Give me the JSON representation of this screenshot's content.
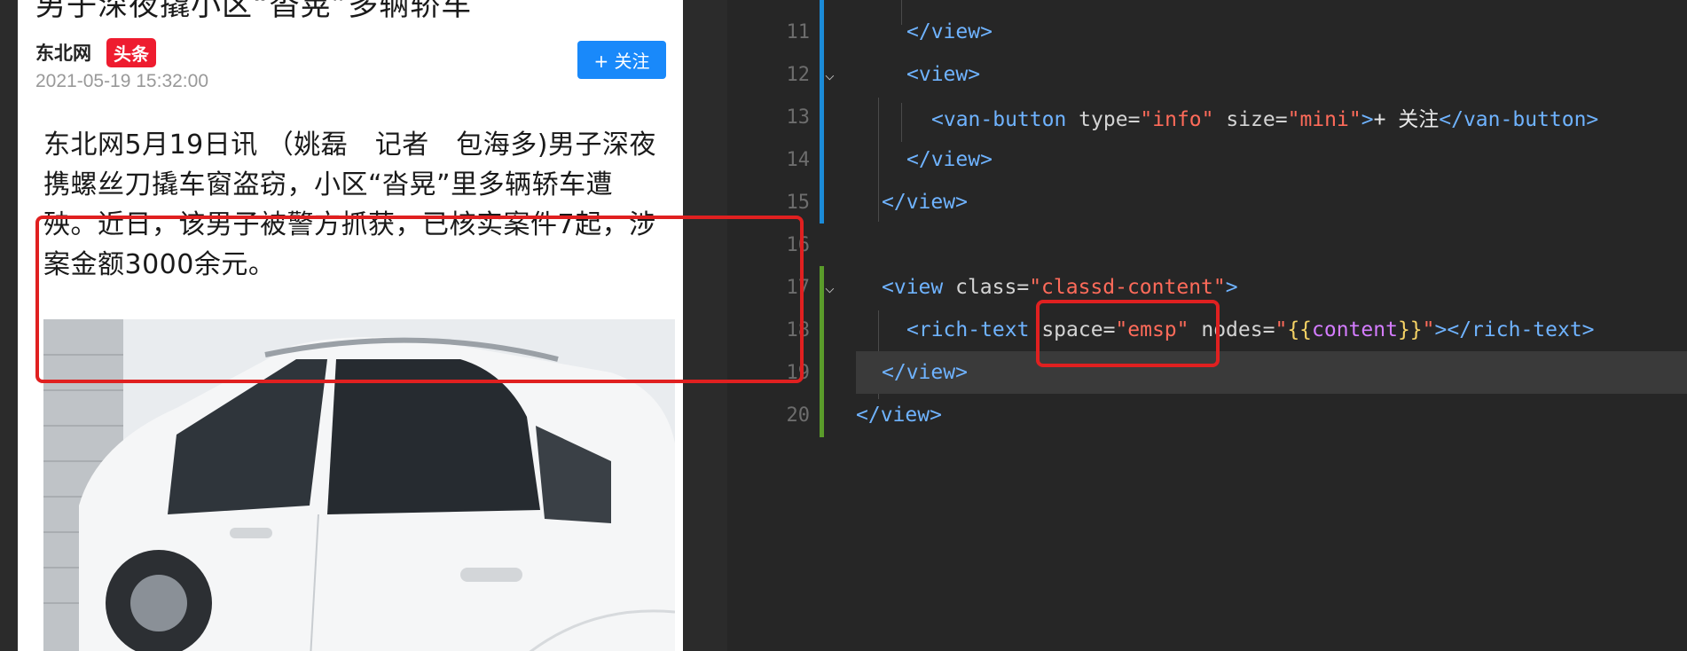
{
  "article": {
    "headline": "男子深夜撬小区“沓晃”多辆轿车",
    "author": "东北网",
    "badge": "头条",
    "datetime": "2021-05-19 15:32:00",
    "follow_label": "+ 关注",
    "content": "东北网5月19日讯 （姚磊　记者　包海多)男子深夜携螺丝刀撬车窗盗窃，小区“沓晃”里多辆轿车遭殃。近日，该男子被警方抓获，已核实案件7起，涉案金额3000余元。"
  },
  "editor": {
    "lines": [
      {
        "no": "11",
        "segments": [
          [
            "tag",
            "</view>"
          ]
        ],
        "indent": 2
      },
      {
        "no": "12",
        "segments": [
          [
            "tag",
            "<view>"
          ]
        ],
        "indent": 2
      },
      {
        "no": "13",
        "segments": [
          [
            "tag",
            "<van-button"
          ],
          [
            "attr",
            " type="
          ],
          [
            "str",
            "\"info\""
          ],
          [
            "attr",
            " size="
          ],
          [
            "str",
            "\"mini\""
          ],
          [
            "tag",
            ">"
          ],
          [
            "plain",
            "+ 关注"
          ],
          [
            "tag",
            "</van-button>"
          ]
        ],
        "indent": 3
      },
      {
        "no": "14",
        "segments": [
          [
            "tag",
            "</view>"
          ]
        ],
        "indent": 2
      },
      {
        "no": "15",
        "segments": [
          [
            "tag",
            "</view>"
          ]
        ],
        "indent": 1
      },
      {
        "no": "16",
        "segments": [],
        "indent": 0
      },
      {
        "no": "17",
        "segments": [
          [
            "tag",
            "<view"
          ],
          [
            "attr",
            " class="
          ],
          [
            "str",
            "\"classd-content\""
          ],
          [
            "tag",
            ">"
          ]
        ],
        "indent": 1
      },
      {
        "no": "18",
        "segments": [
          [
            "tag",
            "<rich-text"
          ],
          [
            "attr",
            " space="
          ],
          [
            "str",
            "\"emsp\""
          ],
          [
            "attr",
            " nodes="
          ],
          [
            "str",
            "\""
          ],
          [
            "brace",
            "{{"
          ],
          [
            "var",
            "content"
          ],
          [
            "brace",
            "}}"
          ],
          [
            "str",
            "\""
          ],
          [
            "tag",
            "></rich-text>"
          ]
        ],
        "indent": 2
      },
      {
        "no": "19",
        "segments": [
          [
            "tag",
            "</view>"
          ]
        ],
        "indent": 1
      },
      {
        "no": "20",
        "segments": [
          [
            "tag",
            "</view>"
          ]
        ],
        "indent": 0
      }
    ]
  },
  "colors": {
    "highlight": "#e02020",
    "follow_button": "#1989fa",
    "badge": "#ee1c2f"
  }
}
